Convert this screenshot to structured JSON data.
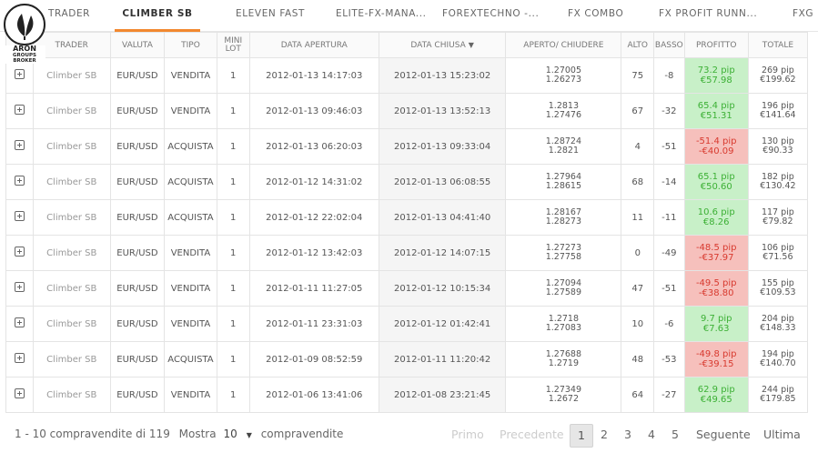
{
  "tabs": [
    "TRADER",
    "CLIMBER SB",
    "ELEVEN FAST",
    "ELITE-FX-MANA...",
    "FOREXTECHNO -...",
    "FX COMBO",
    "FX PROFIT RUNN...",
    "FXG"
  ],
  "logo": {
    "line1": "ARON",
    "line2": "GROUPS",
    "line3": "BROKER"
  },
  "columns": {
    "trader": "TRADER",
    "valuta": "VALUTA",
    "tipo": "TIPO",
    "lot": "MINI LOT",
    "apertura": "DATA APERTURA",
    "chiusa": "DATA CHIUSA",
    "sort_icon": "chevron-down-icon",
    "prices": "APERTO/ CHIUDERE",
    "alto": "ALTO",
    "basso": "BASSO",
    "profitto": "PROFITTO",
    "totale": "TOTALE"
  },
  "colors": {
    "accent": "#f2882f",
    "profit_bg": "#c8f0c8",
    "profit_text": "#3cb035",
    "loss_bg": "#f6c0bc",
    "loss_text": "#d83a2f"
  },
  "rows": [
    {
      "trader": "Climber SB",
      "valuta": "EUR/USD",
      "tipo": "VENDITA",
      "lot": "1",
      "apertura": "2012-01-13 14:17:03",
      "chiusa": "2012-01-13 15:23:02",
      "open": "1.27005",
      "close": "1.26273",
      "alto": "75",
      "basso": "-8",
      "pip": "73.2 pip",
      "eur": "€57.98",
      "positive": true,
      "tot_pip": "269 pip",
      "tot_eur": "€199.62"
    },
    {
      "trader": "Climber SB",
      "valuta": "EUR/USD",
      "tipo": "VENDITA",
      "lot": "1",
      "apertura": "2012-01-13 09:46:03",
      "chiusa": "2012-01-13 13:52:13",
      "open": "1.2813",
      "close": "1.27476",
      "alto": "67",
      "basso": "-32",
      "pip": "65.4 pip",
      "eur": "€51.31",
      "positive": true,
      "tot_pip": "196 pip",
      "tot_eur": "€141.64"
    },
    {
      "trader": "Climber SB",
      "valuta": "EUR/USD",
      "tipo": "ACQUISTA",
      "lot": "1",
      "apertura": "2012-01-13 06:20:03",
      "chiusa": "2012-01-13 09:33:04",
      "open": "1.28724",
      "close": "1.2821",
      "alto": "4",
      "basso": "-51",
      "pip": "-51.4 pip",
      "eur": "-€40.09",
      "positive": false,
      "tot_pip": "130 pip",
      "tot_eur": "€90.33"
    },
    {
      "trader": "Climber SB",
      "valuta": "EUR/USD",
      "tipo": "ACQUISTA",
      "lot": "1",
      "apertura": "2012-01-12 14:31:02",
      "chiusa": "2012-01-13 06:08:55",
      "open": "1.27964",
      "close": "1.28615",
      "alto": "68",
      "basso": "-14",
      "pip": "65.1 pip",
      "eur": "€50.60",
      "positive": true,
      "tot_pip": "182 pip",
      "tot_eur": "€130.42"
    },
    {
      "trader": "Climber SB",
      "valuta": "EUR/USD",
      "tipo": "ACQUISTA",
      "lot": "1",
      "apertura": "2012-01-12 22:02:04",
      "chiusa": "2012-01-13 04:41:40",
      "open": "1.28167",
      "close": "1.28273",
      "alto": "11",
      "basso": "-11",
      "pip": "10.6 pip",
      "eur": "€8.26",
      "positive": true,
      "tot_pip": "117 pip",
      "tot_eur": "€79.82"
    },
    {
      "trader": "Climber SB",
      "valuta": "EUR/USD",
      "tipo": "VENDITA",
      "lot": "1",
      "apertura": "2012-01-12 13:42:03",
      "chiusa": "2012-01-12 14:07:15",
      "open": "1.27273",
      "close": "1.27758",
      "alto": "0",
      "basso": "-49",
      "pip": "-48.5 pip",
      "eur": "-€37.97",
      "positive": false,
      "tot_pip": "106 pip",
      "tot_eur": "€71.56"
    },
    {
      "trader": "Climber SB",
      "valuta": "EUR/USD",
      "tipo": "VENDITA",
      "lot": "1",
      "apertura": "2012-01-11 11:27:05",
      "chiusa": "2012-01-12 10:15:34",
      "open": "1.27094",
      "close": "1.27589",
      "alto": "47",
      "basso": "-51",
      "pip": "-49.5 pip",
      "eur": "-€38.80",
      "positive": false,
      "tot_pip": "155 pip",
      "tot_eur": "€109.53"
    },
    {
      "trader": "Climber SB",
      "valuta": "EUR/USD",
      "tipo": "VENDITA",
      "lot": "1",
      "apertura": "2012-01-11 23:31:03",
      "chiusa": "2012-01-12 01:42:41",
      "open": "1.2718",
      "close": "1.27083",
      "alto": "10",
      "basso": "-6",
      "pip": "9.7 pip",
      "eur": "€7.63",
      "positive": true,
      "tot_pip": "204 pip",
      "tot_eur": "€148.33"
    },
    {
      "trader": "Climber SB",
      "valuta": "EUR/USD",
      "tipo": "ACQUISTA",
      "lot": "1",
      "apertura": "2012-01-09 08:52:59",
      "chiusa": "2012-01-11 11:20:42",
      "open": "1.27688",
      "close": "1.2719",
      "alto": "48",
      "basso": "-53",
      "pip": "-49.8 pip",
      "eur": "-€39.15",
      "positive": false,
      "tot_pip": "194 pip",
      "tot_eur": "€140.70"
    },
    {
      "trader": "Climber SB",
      "valuta": "EUR/USD",
      "tipo": "VENDITA",
      "lot": "1",
      "apertura": "2012-01-06 13:41:06",
      "chiusa": "2012-01-08 23:21:45",
      "open": "1.27349",
      "close": "1.2672",
      "alto": "64",
      "basso": "-27",
      "pip": "62.9 pip",
      "eur": "€49.65",
      "positive": true,
      "tot_pip": "244 pip",
      "tot_eur": "€179.85"
    }
  ],
  "footer": {
    "summary": "1 - 10 compravendite di 119",
    "show_label": "Mostra",
    "page_size": "10",
    "page_size_suffix": "compravendite",
    "first": "Primo",
    "prev": "Precedente",
    "pages": [
      "1",
      "2",
      "3",
      "4",
      "5"
    ],
    "current_page": "1",
    "next": "Seguente",
    "last": "Ultima"
  }
}
